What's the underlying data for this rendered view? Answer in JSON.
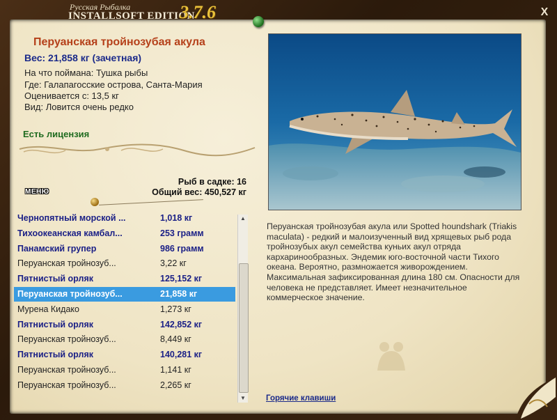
{
  "window": {
    "title_sub": "Русская Рыбалка",
    "title_main": "INSTALLSOFT EDITION",
    "version": "3.7.6",
    "close_label": "X"
  },
  "fish": {
    "name": "Перуанская тройнозубая акула",
    "weight": "Вес: 21,858 кг (зачетная)",
    "caught_on": "На что поймана: Тушка рыбы",
    "location": "Где: Галапагосские острова, Санта-Мария",
    "rated_from": "Оценивается с: 13,5 кг",
    "rarity": "Вид: Ловится очень редко",
    "license": "Есть лицензия",
    "description": "Перуанская тройнозубая акула или Spotted houndshark (Triakis maculata) - редкий и малоизученный вид хрящевых рыб рода тройнозубых акул семейства куньих акул отряда кархаринообразных. Эндемик юго-восточной части Тихого океана. Вероятно, размножается живорождением. Максимальная зафиксированная длина 180 см. Опасности для человека не представляет. Имеет незначительное коммерческое значение."
  },
  "stats": {
    "fish_in_cage": "Рыб в садке: 16",
    "total_weight": "Общий вес: 450,527 кг"
  },
  "menu_label": "МЕНЮ",
  "hotkeys_label": "Горячие клавиши",
  "catch_list": [
    {
      "name": "Чернопятный морской ...",
      "weight": "1,018 кг",
      "style": "bold"
    },
    {
      "name": "Тихоокеанская камбал...",
      "weight": "253 грамм",
      "style": "bold"
    },
    {
      "name": "Панамский групер",
      "weight": "986 грамм",
      "style": "bold"
    },
    {
      "name": "Перуанская тройнозуб...",
      "weight": "3,22 кг",
      "style": "normal"
    },
    {
      "name": "Пятнистый орляк",
      "weight": "125,152 кг",
      "style": "bold"
    },
    {
      "name": "Перуанская тройнозуб...",
      "weight": "21,858 кг",
      "style": "selected"
    },
    {
      "name": "Мурена Кидако",
      "weight": "1,273 кг",
      "style": "normal"
    },
    {
      "name": "Пятнистый орляк",
      "weight": "142,852 кг",
      "style": "bold"
    },
    {
      "name": "Перуанская тройнозуб...",
      "weight": "8,449 кг",
      "style": "normal"
    },
    {
      "name": "Пятнистый орляк",
      "weight": "140,281 кг",
      "style": "bold"
    },
    {
      "name": "Перуанская тройнозуб...",
      "weight": "1,141 кг",
      "style": "normal"
    },
    {
      "name": "Перуанская тройнозуб...",
      "weight": "2,265 кг",
      "style": "normal"
    }
  ],
  "icons": {
    "close": "close-icon",
    "scroll_up": "scroll-up-arrow-icon",
    "scroll_down": "scroll-down-arrow-icon",
    "pin": "green-pin-icon",
    "mascot": "mascot-silhouette-icon"
  },
  "colors": {
    "title_red": "#b5401a",
    "weight_blue": "#1b2a8a",
    "license_green": "#1f6b1f",
    "selection": "#3a9be0",
    "parchment": "#f2e9cf"
  }
}
